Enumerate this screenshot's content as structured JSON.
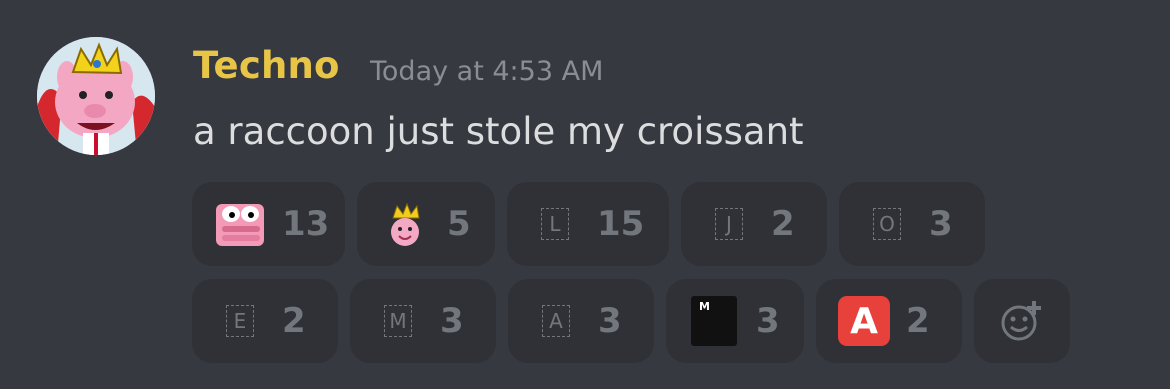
{
  "message": {
    "author": "Techno",
    "timestamp": "Today at 4:53 AM",
    "text": "a raccoon just stole my croissant",
    "author_color": "#e8c547",
    "reactions": [
      {
        "emoji": "pink-pig-face-emoji",
        "count": "13"
      },
      {
        "emoji": "crowned-pig-emoji",
        "count": "5"
      },
      {
        "emoji": "L",
        "count": "15"
      },
      {
        "emoji": "J",
        "count": "2"
      },
      {
        "emoji": "O",
        "count": "3"
      },
      {
        "emoji": "E",
        "count": "2"
      },
      {
        "emoji": "M",
        "count": "3"
      },
      {
        "emoji": "A",
        "count": "3"
      },
      {
        "emoji": "M",
        "count": "3"
      },
      {
        "emoji": "A",
        "count": "2"
      }
    ]
  },
  "icons": {
    "add_reaction": "add-reaction-icon"
  }
}
